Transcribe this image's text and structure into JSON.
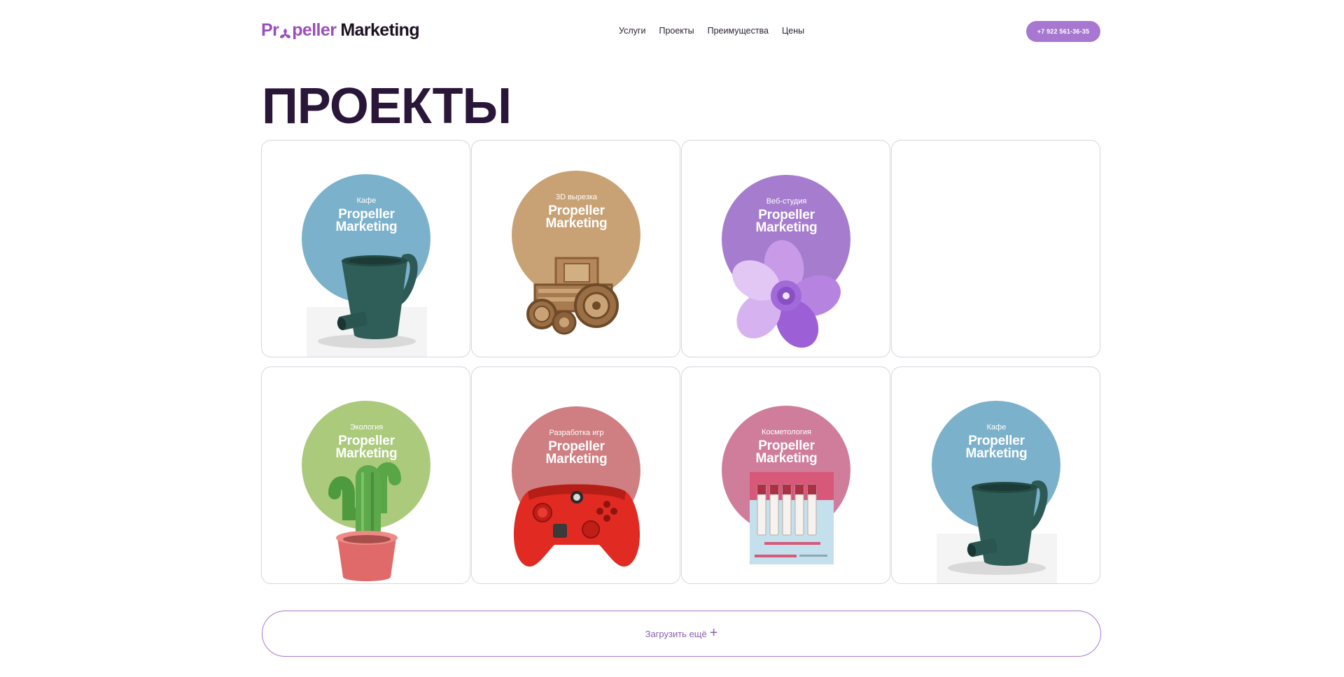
{
  "header": {
    "logo_brand_a": "Pr",
    "logo_brand_b": "peller",
    "logo_rest": "Marketing",
    "nav": [
      "Услуги",
      "Проекты",
      "Преимущества",
      "Цены"
    ],
    "phone": "+7 922 561-36-35"
  },
  "page": {
    "title": "ПРОЕКТЫ"
  },
  "projects": [
    {
      "category": "Кафе",
      "name": "Propeller\nMarketing",
      "color": "#7bb1cb",
      "object": "mug-icon"
    },
    {
      "category": "3D вырезка",
      "name": "Propeller\nMarketing",
      "color": "#c8a275",
      "object": "wooden-tractor-icon"
    },
    {
      "category": "Веб-студия",
      "name": "Propeller\nMarketing",
      "color": "#a67ccf",
      "object": "flower-icon"
    },
    {
      "category": "Экология",
      "name": "Propeller\nMarketing",
      "color": "#abca7c",
      "object": "cactus-icon"
    },
    {
      "category": "Разработка игр",
      "name": "Propeller\nMarketing",
      "color": "#cf7e82",
      "object": "gamepad-icon"
    },
    {
      "category": "Косметология",
      "name": "Propeller\nMarketing",
      "color": "#cf7d9a",
      "object": "lipstick-box-icon"
    },
    {
      "category": "Кафе",
      "name": "Propeller\nMarketing",
      "color": "#7bb1cb",
      "object": "mug-icon"
    }
  ],
  "load_more": {
    "label": "Загрузить ещё",
    "icon": "plus-icon"
  }
}
